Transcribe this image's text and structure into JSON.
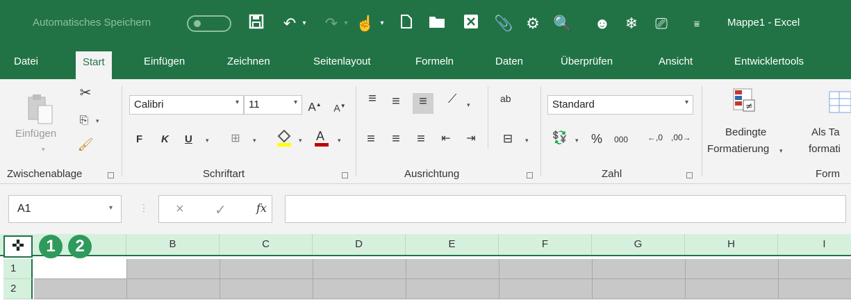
{
  "titlebar": {
    "autosave_label": "Automatisches Speichern",
    "window_title": "Mappe1  -  Excel",
    "quick_access_icons": [
      "save-icon",
      "undo-icon",
      "redo-icon",
      "touch-mode-icon",
      "new-file-icon",
      "open-folder-icon",
      "excel-close-icon",
      "attach-icon",
      "camera-icon",
      "print-preview-icon",
      "smiley-icon",
      "snowflake-icon",
      "device-icon",
      "customize-icon"
    ]
  },
  "tabs": [
    "Datei",
    "Start",
    "Einfügen",
    "Zeichnen",
    "Seitenlayout",
    "Formeln",
    "Daten",
    "Überprüfen",
    "Ansicht",
    "Entwicklertools"
  ],
  "active_tab": "Start",
  "ribbon": {
    "clipboard": {
      "paste_label": "Einfügen",
      "group_label": "Zwischenablage"
    },
    "font": {
      "name": "Calibri",
      "size": "11",
      "bold": "F",
      "italic": "K",
      "underline": "U",
      "group_label": "Schriftart",
      "highlight_color": "#ffff00",
      "font_color": "#c00000"
    },
    "alignment": {
      "group_label": "Ausrichtung",
      "wrap_label": "ab"
    },
    "number": {
      "format": "Standard",
      "percent": "%",
      "thousands": "000",
      "group_label": "Zahl"
    },
    "styles": {
      "conditional_line1": "Bedingte",
      "conditional_line2": "Formatierung",
      "table_line1": "Als Ta",
      "table_line2": "formati",
      "group_label": "Form"
    }
  },
  "formula_bar": {
    "name_box": "A1",
    "fx_label": "fx",
    "cancel": "×",
    "enter": "✓"
  },
  "grid": {
    "select_all_icon": "plus-cursor-icon",
    "badges": [
      "1",
      "2"
    ],
    "columns": [
      "B",
      "C",
      "D",
      "E",
      "F",
      "G",
      "H",
      "I"
    ],
    "rows": [
      "1",
      "2"
    ]
  },
  "colors": {
    "brand": "#217346",
    "header_bg": "#d6f0de",
    "badge": "#2e9a5c"
  }
}
